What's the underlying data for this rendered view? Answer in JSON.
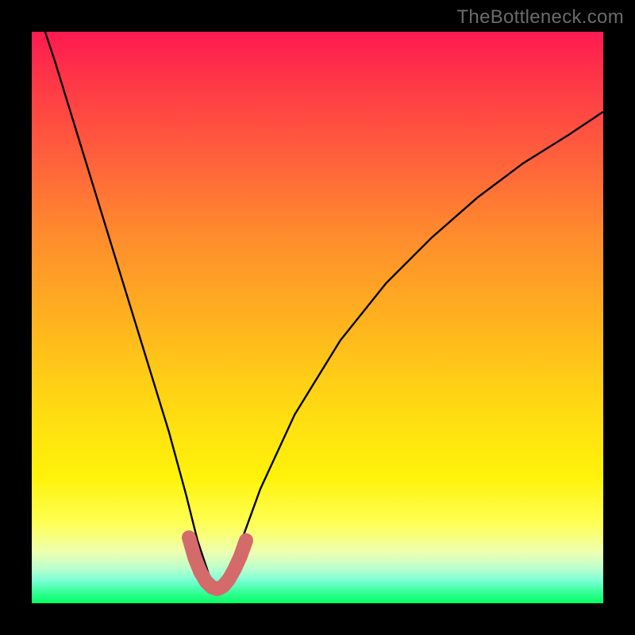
{
  "watermark": "TheBottleneck.com",
  "chart_data": {
    "type": "line",
    "title": "",
    "xlabel": "",
    "ylabel": "",
    "xlim": [
      0,
      100
    ],
    "ylim": [
      0,
      100
    ],
    "series": [
      {
        "name": "bottleneck-curve",
        "x": [
          0,
          4,
          8,
          12,
          16,
          20,
          24,
          27,
          29,
          31,
          32.5,
          34,
          36,
          40,
          46,
          54,
          62,
          70,
          78,
          86,
          94,
          100
        ],
        "y": [
          107,
          95,
          82,
          69,
          56,
          43,
          30,
          19,
          11,
          5,
          2.5,
          4,
          9,
          20,
          33,
          46,
          56,
          64,
          71,
          77,
          82,
          86
        ]
      }
    ],
    "marker_band": {
      "name": "optimal-range",
      "x": [
        27.5,
        28.5,
        29.5,
        30.5,
        31.5,
        32.5,
        33.5,
        34.5,
        35.5,
        36.5,
        37.5
      ],
      "y": [
        11.5,
        8.0,
        5.5,
        3.8,
        2.8,
        2.5,
        3.0,
        4.2,
        6.0,
        8.2,
        11.0
      ]
    },
    "gradient_stops": [
      {
        "pos": 0,
        "color": "#ff1a52"
      },
      {
        "pos": 8,
        "color": "#ff3547"
      },
      {
        "pos": 20,
        "color": "#ff5a3e"
      },
      {
        "pos": 35,
        "color": "#ff8a2e"
      },
      {
        "pos": 50,
        "color": "#ffb11f"
      },
      {
        "pos": 65,
        "color": "#ffd813"
      },
      {
        "pos": 78,
        "color": "#fff30a"
      },
      {
        "pos": 86,
        "color": "#ffff55"
      },
      {
        "pos": 91,
        "color": "#eeffb0"
      },
      {
        "pos": 94,
        "color": "#b8ffce"
      },
      {
        "pos": 96,
        "color": "#7cffd6"
      },
      {
        "pos": 98,
        "color": "#38ff9c"
      },
      {
        "pos": 100,
        "color": "#05ff61"
      }
    ],
    "colors": {
      "curve": "#000000",
      "marker": "#d46a6a",
      "frame": "#000000"
    }
  }
}
